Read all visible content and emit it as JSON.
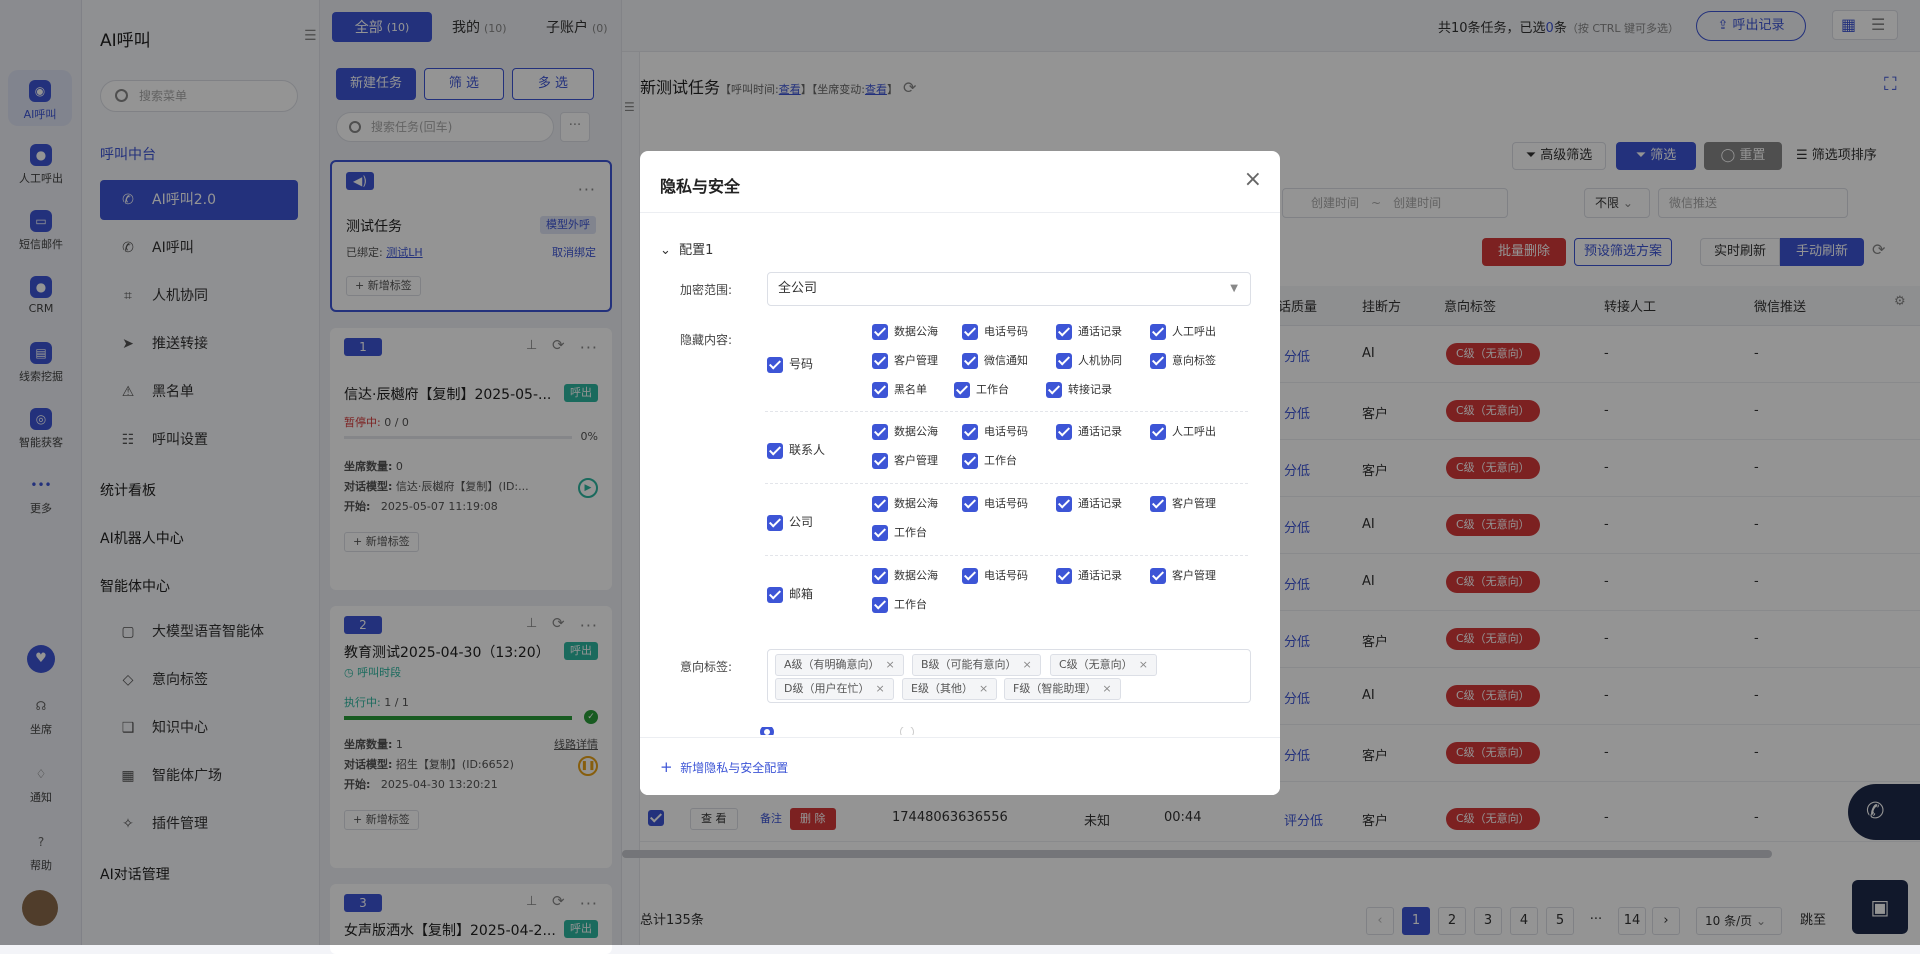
{
  "rail": [
    {
      "label": "AI呼叫",
      "icon": "ai-call-icon"
    },
    {
      "label": "人工呼出",
      "icon": "manual-call-icon"
    },
    {
      "label": "短信邮件",
      "icon": "sms-icon"
    },
    {
      "label": "CRM",
      "icon": "crm-icon"
    },
    {
      "label": "线索挖掘",
      "icon": "lead-icon"
    },
    {
      "label": "智能获客",
      "icon": "acquire-icon"
    },
    {
      "label": "更多",
      "icon": "more-icon"
    },
    {
      "label": "坐席",
      "icon": "seat-icon"
    },
    {
      "label": "通知",
      "icon": "bell-icon"
    },
    {
      "label": "帮助",
      "icon": "help-icon"
    }
  ],
  "nav": {
    "title": "AI呼叫",
    "search_placeholder": "搜索菜单",
    "group1": "呼叫中台",
    "items1": [
      "AI呼叫2.0",
      "AI呼叫",
      "人机协同",
      "推送转接",
      "黑名单",
      "呼叫设置"
    ],
    "group2": "统计看板",
    "group3": "AI机器人中心",
    "group4": "智能体中心",
    "items4": [
      "大模型语音智能体",
      "意向标签",
      "知识中心",
      "智能体广场",
      "插件管理"
    ],
    "group5": "AI对话管理"
  },
  "tabs": {
    "all": "全部",
    "all_count": "(10)",
    "mine": "我的",
    "mine_count": "(10)",
    "sub": "子账户",
    "sub_count": "(0)"
  },
  "summary": {
    "pre": "共10条任务，已选",
    "selected": "0",
    "post": "条",
    "hint": "（按 CTRL 键可多选）",
    "export": "呼出记录"
  },
  "task_toolbar": {
    "new": "新建任务",
    "filter": "筛 选",
    "multi": "多 选",
    "search_placeholder": "搜索任务(回车)"
  },
  "cards": [
    {
      "title": "测试任务",
      "tag": "模型外呼",
      "bound_label": "已绑定:",
      "bound": "测试LH",
      "unbind": "取消绑定",
      "add": "+ 新增标签"
    },
    {
      "num": "1",
      "title": "信达·辰樾府【复制】2025-05-...",
      "tag": "呼出",
      "status": "暂停中:",
      "progress": "0 / 0",
      "pct": "0%",
      "seats_label": "坐席数量:",
      "seats": "0",
      "model_label": "对话模型:",
      "model": "信达·辰樾府【复制】(ID:...",
      "start_label": "开始:",
      "start": "2025-05-07 11:19:08",
      "add": "+ 新增标签"
    },
    {
      "num": "2",
      "title": "教育测试2025-04-30（13:20）",
      "tag": "呼出",
      "period": "呼叫时段",
      "status": "执行中:",
      "progress": "1 / 1",
      "seats_label": "坐席数量:",
      "seats": "1",
      "detail": "线路详情",
      "model_label": "对话模型:",
      "model": "招生【复制】(ID:6652)",
      "start_label": "开始:",
      "start": "2025-04-30 13:20:21",
      "add": "+ 新增标签"
    },
    {
      "num": "3",
      "title": "女声版洒水【复制】2025-04-2...",
      "tag": "呼出"
    }
  ],
  "main": {
    "title": "新测试任务",
    "meta1": "【呼叫时间:",
    "view1": "查看",
    "meta2": "】【坐席变动:",
    "view2": "查看",
    "meta3": "】",
    "adv_filter": "高级筛选",
    "filter": "筛选",
    "reset": "重置",
    "sort": "筛选项排序",
    "create_from": "创建时间",
    "create_to": "创建时间",
    "range_sep": "~",
    "unlimited": "不限",
    "wechat": "微信推送",
    "batch_delete": "批量删除",
    "preset": "预设筛选方案",
    "realtime": "实时刷新",
    "manual": "手动刷新",
    "headers": {
      "quality": "话质量",
      "hangup": "挂断方",
      "intent": "意向标签",
      "transfer": "转接人工",
      "wechat": "微信推送"
    },
    "rows": [
      {
        "quality": "分低",
        "hangup": "AI",
        "intent": "C级（无意向）",
        "transfer": "-",
        "wechat": "-"
      },
      {
        "quality": "分低",
        "hangup": "客户",
        "intent": "C级（无意向）",
        "transfer": "-",
        "wechat": "-"
      },
      {
        "quality": "分低",
        "hangup": "客户",
        "intent": "C级（无意向）",
        "transfer": "-",
        "wechat": "-"
      },
      {
        "quality": "分低",
        "hangup": "AI",
        "intent": "C级（无意向）",
        "transfer": "-",
        "wechat": "-"
      },
      {
        "quality": "分低",
        "hangup": "AI",
        "intent": "C级（无意向）",
        "transfer": "-",
        "wechat": "-"
      },
      {
        "quality": "分低",
        "hangup": "客户",
        "intent": "C级（无意向）",
        "transfer": "-",
        "wechat": "-"
      },
      {
        "quality": "分低",
        "hangup": "AI",
        "intent": "C级（无意向）",
        "transfer": "-",
        "wechat": "-"
      },
      {
        "quality": "分低",
        "hangup": "客户",
        "intent": "C级（无意向）",
        "transfer": "-",
        "wechat": "-"
      }
    ],
    "last_row": {
      "view": "查 看",
      "note": "备注",
      "del": "删 除",
      "phone": "17448063636556",
      "status": "未知",
      "duration": "00:44",
      "quality": "评分低",
      "hangup": "客户",
      "intent": "C级（无意向）",
      "transfer": "-",
      "wechat": "-"
    },
    "total": "总计135条",
    "pages": [
      "1",
      "2",
      "3",
      "4",
      "5",
      "···",
      "14"
    ],
    "page_size": "10 条/页",
    "jump": "跳至"
  },
  "modal": {
    "title": "隐私与安全",
    "config": "配置1",
    "scope_label": "加密范围:",
    "scope_value": "全公司",
    "hide_label": "隐藏内容:",
    "groups": [
      {
        "name": "号码",
        "opts": [
          "数据公海",
          "电话号码",
          "通话记录",
          "人工呼出",
          "客户管理",
          "微信通知",
          "人机协同",
          "意向标签",
          "黑名单",
          "工作台",
          "转接记录"
        ]
      },
      {
        "name": "联系人",
        "opts": [
          "数据公海",
          "电话号码",
          "通话记录",
          "人工呼出",
          "客户管理",
          "工作台"
        ]
      },
      {
        "name": "公司",
        "opts": [
          "数据公海",
          "电话号码",
          "通话记录",
          "客户管理",
          "工作台"
        ]
      },
      {
        "name": "邮箱",
        "opts": [
          "数据公海",
          "电话号码",
          "通话记录",
          "客户管理",
          "工作台"
        ]
      }
    ],
    "intent_label": "意向标签:",
    "chips": [
      "A级（有明确意向）",
      "B级（可能有意向）",
      "C级（无意向）",
      "D级（用户在忙）",
      "E级（其他）",
      "F级（智能助理）"
    ],
    "add_config": "新增隐私与安全配置"
  },
  "colors": {
    "primary": "#3d55d6",
    "danger": "#d63a3a",
    "success": "#2db7a0"
  }
}
